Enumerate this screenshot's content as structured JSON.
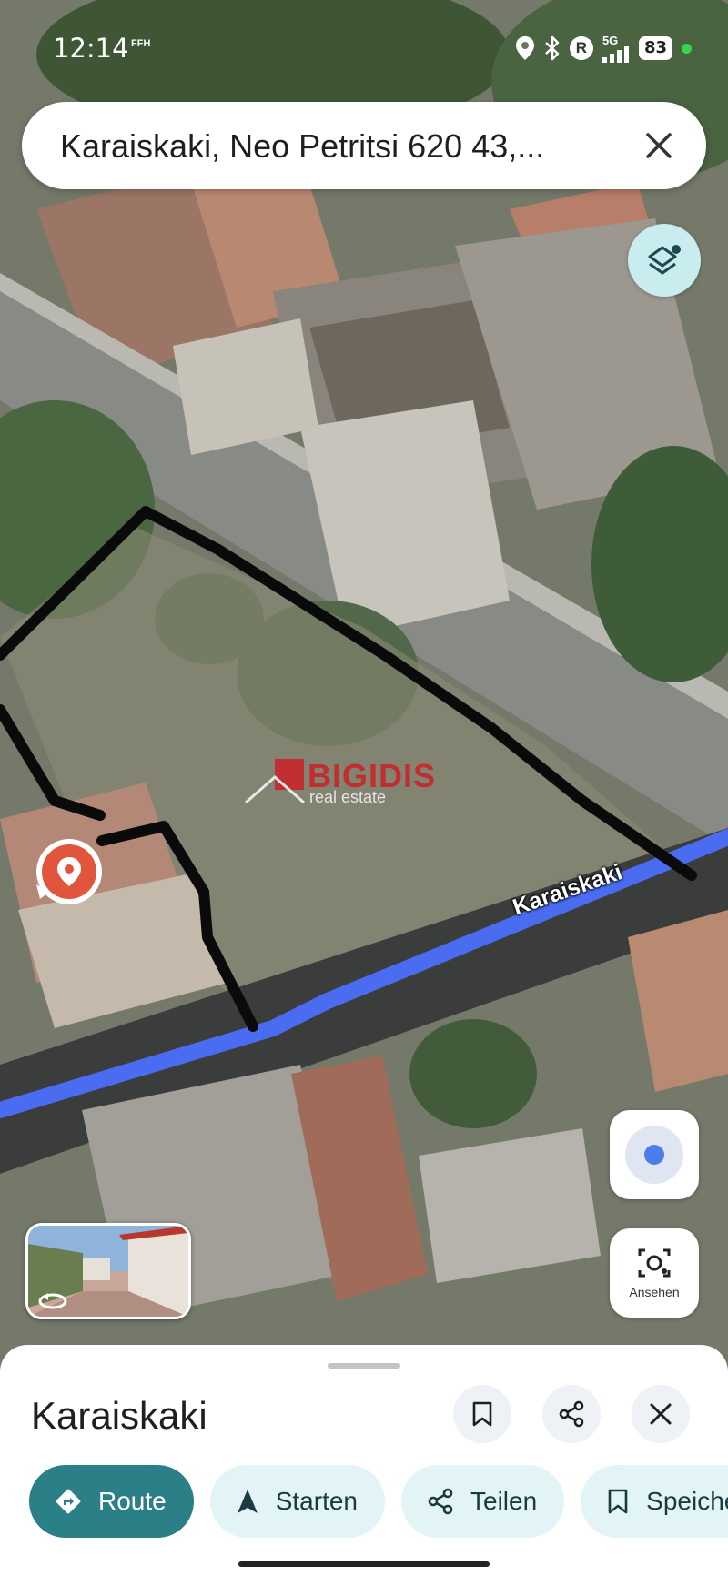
{
  "status_bar": {
    "time": "12:14",
    "sub_label": "FFH",
    "network": "5G",
    "battery": "83",
    "icons": [
      "location-icon",
      "bluetooth-icon",
      "r-badge-icon",
      "signal-icon",
      "battery-icon"
    ]
  },
  "search": {
    "query": "Karaiskaki, Neo Petritsi 620 43,..."
  },
  "map": {
    "street_label": "Karaiskaki",
    "watermark_brand": "BIGIDIS",
    "watermark_sub": "real estate",
    "route_color": "#4a6cf0",
    "pin_color": "#e0553c"
  },
  "controls": {
    "lens_label": "Ansehen"
  },
  "sheet": {
    "title": "Karaiskaki",
    "chips": {
      "route": "Route",
      "start": "Starten",
      "share": "Teilen",
      "save": "Speichern"
    }
  },
  "colors": {
    "accent": "#2b7f86",
    "chip_bg": "#e3f4f7",
    "layers_bg": "#c9ecef"
  }
}
